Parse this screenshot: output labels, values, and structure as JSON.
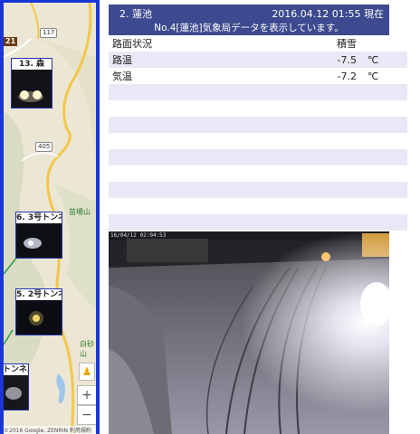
{
  "map": {
    "route_label_hw": "21",
    "route_labels": [
      "117",
      "405"
    ],
    "place_labels": [
      "苗場山",
      "白砂山"
    ],
    "cameras": [
      {
        "label": "13. 森"
      },
      {
        "label": "6. 3号トンネル"
      },
      {
        "label": "5. 2号トンネル"
      },
      {
        "label": "トンネル"
      }
    ],
    "zoom_in": "+",
    "zoom_out": "−",
    "copyright": "©2016 Google, ZENRIN   利用規約"
  },
  "station": {
    "name": "2. 蓮池",
    "datetime": "2016.04.12 01:55 現在",
    "subtitle": "No.4[蓮池]気象局データを表示しています。"
  },
  "table": {
    "rows": [
      {
        "label": "路面状況",
        "value": "積雪",
        "unit": ""
      },
      {
        "label": "路温",
        "value": "-7.5",
        "unit": "℃"
      },
      {
        "label": "気温",
        "value": "-7.2",
        "unit": "℃"
      },
      {
        "label": "",
        "value": "",
        "unit": ""
      },
      {
        "label": "",
        "value": "",
        "unit": ""
      },
      {
        "label": "",
        "value": "",
        "unit": ""
      },
      {
        "label": "",
        "value": "",
        "unit": ""
      },
      {
        "label": "",
        "value": "",
        "unit": ""
      },
      {
        "label": "",
        "value": "",
        "unit": ""
      },
      {
        "label": "",
        "value": "",
        "unit": ""
      },
      {
        "label": "",
        "value": "",
        "unit": ""
      },
      {
        "label": "",
        "value": "",
        "unit": ""
      }
    ]
  },
  "camera": {
    "timestamp": "16/04/12 02:04:53"
  },
  "colors": {
    "header_bg": "#3d4a8f",
    "map_border": "#1a35d8",
    "stripe": "#e8e8f6"
  }
}
